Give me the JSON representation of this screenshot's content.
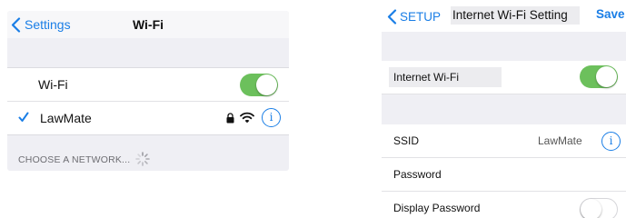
{
  "left": {
    "nav": {
      "back_label": "Settings",
      "title": "Wi-Fi"
    },
    "wifi_row": {
      "label": "Wi-Fi",
      "toggle_on": true
    },
    "network": {
      "name": "LawMate",
      "connected": true,
      "icons": [
        "checkmark-icon",
        "lock-icon",
        "wifi-signal-icon",
        "info-icon"
      ]
    },
    "choose_label": "CHOOSE A NETWORK...",
    "info_glyph": "i"
  },
  "right": {
    "nav": {
      "back_label": "SETUP",
      "title": "Internet Wi-Fi Setting",
      "save_label": "Save"
    },
    "internet_wifi": {
      "label": "Internet Wi-Fi",
      "toggle_on": true
    },
    "ssid": {
      "label": "SSID",
      "value": "LawMate"
    },
    "password": {
      "label": "Password"
    },
    "display_password": {
      "label": "Display Password",
      "toggle_on": false
    },
    "info_glyph": "i"
  },
  "colors": {
    "accent": "#1a7ee6",
    "toggle_on": "#6cc05c",
    "group_bg": "#efeff4"
  }
}
